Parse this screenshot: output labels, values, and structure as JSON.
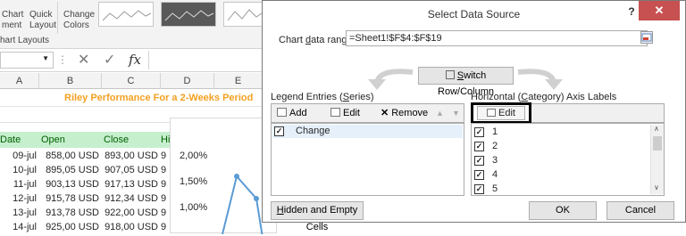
{
  "ribbon": {
    "chart_element_label_1": "Chart",
    "chart_element_label_2": "ment",
    "quick_layout_label_1": "Quick",
    "quick_layout_label_2": "Layout",
    "change_colors_label_1": "Change",
    "change_colors_label_2": "Colors",
    "group_label": "hart Layouts"
  },
  "formula_bar": {
    "cancel_glyph": "✕",
    "enter_glyph": "✓",
    "fx_glyph": "fx"
  },
  "columns": [
    "A",
    "B",
    "C",
    "D",
    "E"
  ],
  "sheet": {
    "title": "Riley Performance For a 2-Weeks Period",
    "headers": [
      "Date",
      "Open",
      "Close",
      "Hi"
    ],
    "rows": [
      [
        "09-jul",
        "858,00 USD",
        "893,00 USD",
        "9"
      ],
      [
        "10-jul",
        "895,05 USD",
        "907,05 USD",
        "9"
      ],
      [
        "11-jul",
        "903,13 USD",
        "917,13 USD",
        "9"
      ],
      [
        "12-jul",
        "915,78 USD",
        "912,34 USD",
        "9"
      ],
      [
        "13-jul",
        "913,78 USD",
        "922,00 USD",
        "9"
      ],
      [
        "14-jul",
        "925,00 USD",
        "918,00 USD",
        "9"
      ]
    ],
    "chart_ticks": [
      "2,00%",
      "1,50%",
      "1,00%"
    ]
  },
  "dialog": {
    "title": "Select Data Source",
    "help": "?",
    "close": "✕",
    "range_label": "Chart data range:",
    "range_value": "=Sheet1!$F$4:$F$19",
    "switch_label": "Switch Row/Column",
    "legend_header": "Legend Entries (Series)",
    "axis_header": "Horizontal (Category) Axis Labels",
    "add_label": "Add",
    "edit_label": "Edit",
    "remove_label": "Remove",
    "up_arrow": "▲",
    "down_arrow": "▼",
    "axis_edit_label": "Edit",
    "series": [
      {
        "name": "Change",
        "checked": true
      }
    ],
    "categories": [
      {
        "label": "1",
        "checked": true
      },
      {
        "label": "2",
        "checked": true
      },
      {
        "label": "3",
        "checked": true
      },
      {
        "label": "4",
        "checked": true
      },
      {
        "label": "5",
        "checked": true
      }
    ],
    "hidden_empty_label": "Hidden and Empty Cells",
    "ok_label": "OK",
    "cancel_label": "Cancel"
  },
  "colors": {
    "header_fill": "#c6efce",
    "header_text": "#006100",
    "title_text": "#f4a021",
    "close_button": "#c75050",
    "series_line": "#5b9bd5"
  }
}
